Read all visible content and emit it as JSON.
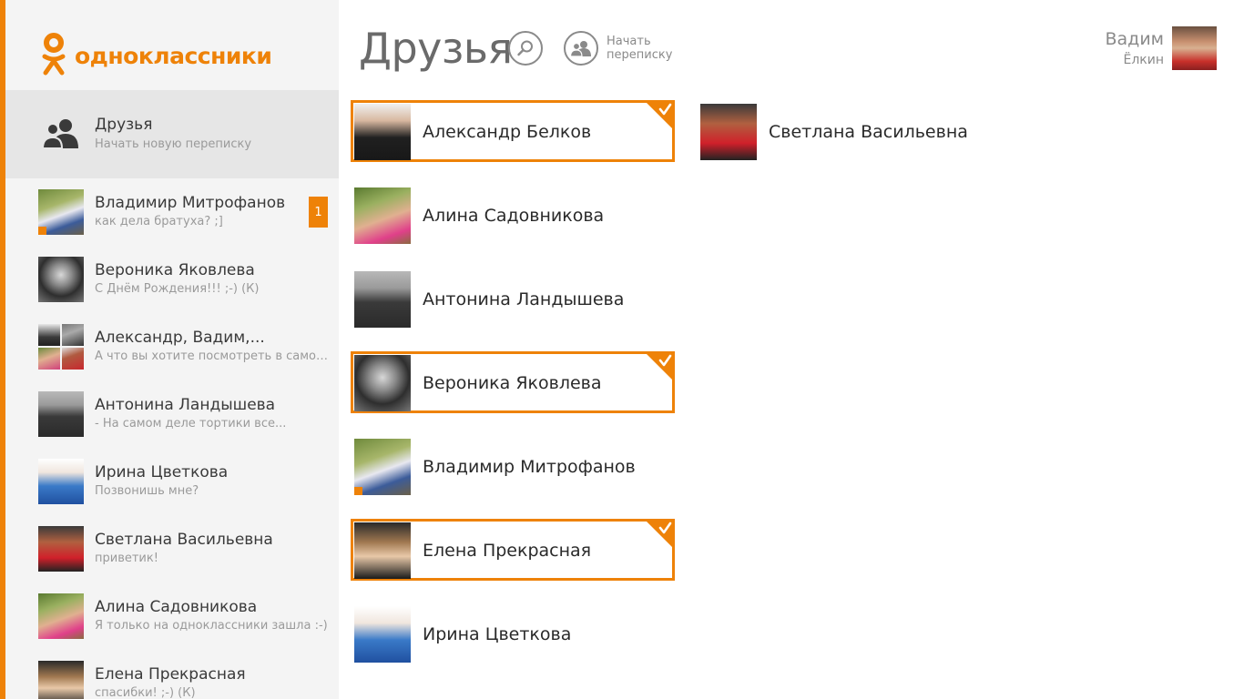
{
  "colors": {
    "accent": "#ee8208",
    "sidebar_bg": "#f4f4f4",
    "sidebar_active": "#e6e6e6"
  },
  "logo": {
    "text": "одноклассники"
  },
  "sidebar": {
    "friends_header": {
      "title": "Друзья",
      "subtitle": "Начать новую переписку",
      "icon": "people-icon"
    },
    "chats": [
      {
        "name": "Владимир Митрофанов",
        "last": "как дела братуха? ;]",
        "unread": "1",
        "online": true
      },
      {
        "name": "Вероника Яковлева",
        "last": "С Днём Рождения!!! ;-) (К)"
      },
      {
        "name": "Александр, Вадим,...",
        "last": "А что вы хотите посмотреть в самом...",
        "group": true
      },
      {
        "name": "Антонина Ландышева",
        "last": "- На самом деле тортики все..."
      },
      {
        "name": "Ирина Цветкова",
        "last": "Позвонишь мне?"
      },
      {
        "name": "Светлана Васильевна",
        "last": "приветик!"
      },
      {
        "name": "Алина Садовникова",
        "last": "Я только на одноклассники зашла :-)"
      },
      {
        "name": "Елена Прекрасная",
        "last": "спасибки! ;-) (К)"
      }
    ]
  },
  "header": {
    "title": "Друзья",
    "search_icon": "search-icon",
    "new_chat": {
      "label_line1": "Начать",
      "label_line2": "переписку",
      "icon": "group-chat-icon"
    },
    "user": {
      "first_name": "Вадим",
      "last_name": "Ёлкин"
    }
  },
  "friends": [
    {
      "name": "Александр Белков",
      "selected": true
    },
    {
      "name": "Светлана Васильевна",
      "selected": false
    },
    {
      "name": "Алина Садовникова",
      "selected": false
    },
    {
      "name": "Антонина Ландышева",
      "selected": false
    },
    {
      "name": "Вероника Яковлева",
      "selected": true
    },
    {
      "name": "Владимир Митрофанов",
      "selected": false,
      "online": true
    },
    {
      "name": "Елена Прекрасная",
      "selected": true
    },
    {
      "name": "Ирина Цветкова",
      "selected": false
    }
  ]
}
